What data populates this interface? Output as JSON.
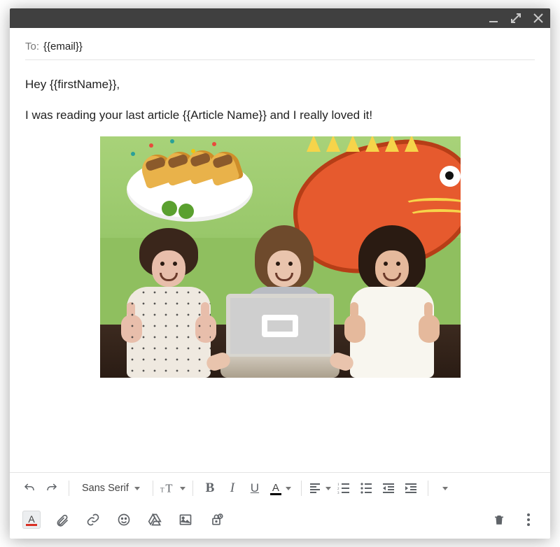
{
  "to_label": "To:",
  "to_value": "{{email}}",
  "body": {
    "greeting": "Hey {{firstName}},",
    "line1": "I was reading your last article {{Article Name}} and I really loved it!"
  },
  "format": {
    "font_family_label": "Sans Serif",
    "bold": "B",
    "italic": "I",
    "underline": "U",
    "text_color": "A"
  },
  "icons": {
    "minimize": "minimize-icon",
    "expand": "expand-icon",
    "close": "close-icon",
    "undo": "undo-icon",
    "redo": "redo-icon",
    "font_size": "font-size-icon",
    "align": "align-icon",
    "numbered": "numbered-list-icon",
    "bulleted": "bulleted-list-icon",
    "indent_less": "indent-decrease-icon",
    "indent_more": "indent-increase-icon",
    "more_format": "more-formatting-icon",
    "text_format": "text-format-icon",
    "attach": "attach-file-icon",
    "link": "insert-link-icon",
    "emoji": "emoji-icon",
    "drive": "drive-icon",
    "image": "insert-photo-icon",
    "confidential": "confidential-mode-icon",
    "delete": "delete-icon",
    "more": "more-options-icon"
  },
  "colors": {
    "titlebar": "#404040",
    "icon": "#5f6368",
    "text_color_underline": "#000000",
    "format_a_underline": "#d93025"
  }
}
